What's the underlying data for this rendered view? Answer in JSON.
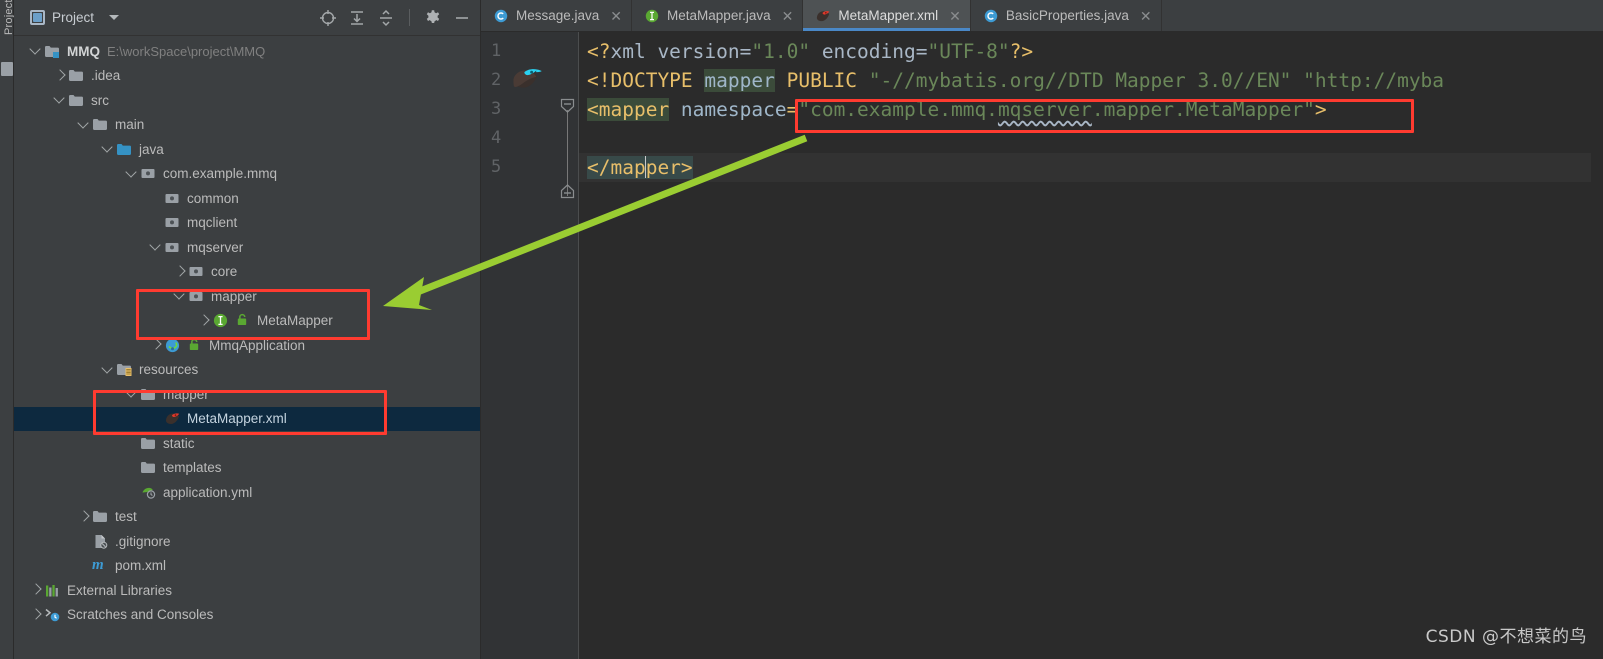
{
  "toolstrip": {
    "label": "Project"
  },
  "panel": {
    "title": "Project",
    "tools": [
      {
        "name": "locate-icon",
        "label": "Select Opened File"
      },
      {
        "name": "expand-all-icon",
        "label": "Expand All"
      },
      {
        "name": "collapse-all-icon",
        "label": "Collapse All"
      },
      {
        "name": "gear-icon",
        "label": "Settings"
      },
      {
        "name": "minimize-icon",
        "label": "Hide"
      }
    ]
  },
  "tree": [
    {
      "depth": 0,
      "arrow": "down",
      "icon": "module-folder-icon",
      "label": "MMQ",
      "bold": true,
      "sub": "E:\\workSpace\\project\\MMQ"
    },
    {
      "depth": 1,
      "arrow": "right",
      "icon": "folder-icon",
      "label": ".idea"
    },
    {
      "depth": 1,
      "arrow": "down",
      "icon": "folder-icon",
      "label": "src"
    },
    {
      "depth": 2,
      "arrow": "down",
      "icon": "folder-icon",
      "label": "main"
    },
    {
      "depth": 3,
      "arrow": "down",
      "icon": "source-folder-icon",
      "label": "java"
    },
    {
      "depth": 4,
      "arrow": "down",
      "icon": "package-icon",
      "label": "com.example.mmq"
    },
    {
      "depth": 5,
      "arrow": "none",
      "icon": "package-icon",
      "label": "common"
    },
    {
      "depth": 5,
      "arrow": "none",
      "icon": "package-icon",
      "label": "mqclient"
    },
    {
      "depth": 5,
      "arrow": "down",
      "icon": "package-icon",
      "label": "mqserver"
    },
    {
      "depth": 6,
      "arrow": "right",
      "icon": "package-icon",
      "label": "core"
    },
    {
      "depth": 6,
      "arrow": "down",
      "icon": "package-icon",
      "label": "mapper"
    },
    {
      "depth": 7,
      "arrow": "right",
      "icon": "interface-icon",
      "label": "MetaMapper",
      "badge": "lock-green-icon"
    },
    {
      "depth": 5,
      "arrow": "right",
      "icon": "spring-class-icon",
      "label": "MmqApplication",
      "badge": "lock-green-icon"
    },
    {
      "depth": 3,
      "arrow": "down",
      "icon": "resource-folder-icon",
      "label": "resources"
    },
    {
      "depth": 4,
      "arrow": "down",
      "icon": "folder-icon",
      "label": "mapper"
    },
    {
      "depth": 5,
      "arrow": "none",
      "icon": "mybatis-icon",
      "label": "MetaMapper.xml",
      "selected": true
    },
    {
      "depth": 4,
      "arrow": "none",
      "icon": "folder-icon",
      "label": "static"
    },
    {
      "depth": 4,
      "arrow": "none",
      "icon": "folder-icon",
      "label": "templates"
    },
    {
      "depth": 4,
      "arrow": "none",
      "icon": "yaml-icon",
      "label": "application.yml"
    },
    {
      "depth": 2,
      "arrow": "right",
      "icon": "folder-icon",
      "label": "test"
    },
    {
      "depth": 2,
      "arrow": "none",
      "icon": "gitignore-icon",
      "label": ".gitignore"
    },
    {
      "depth": 2,
      "arrow": "none",
      "icon": "maven-icon",
      "label": "pom.xml"
    },
    {
      "depth": 0,
      "arrow": "right",
      "icon": "libraries-icon",
      "label": "External Libraries"
    },
    {
      "depth": 0,
      "arrow": "right",
      "icon": "scratches-icon",
      "label": "Scratches and Consoles"
    }
  ],
  "tabs": [
    {
      "label": "Message.java",
      "icon": "java-class-icon",
      "active": false,
      "closable": true
    },
    {
      "label": "MetaMapper.java",
      "icon": "java-interface-icon",
      "active": false,
      "closable": true
    },
    {
      "label": "MetaMapper.xml",
      "icon": "mybatis-icon",
      "active": true,
      "closable": true
    },
    {
      "label": "BasicProperties.java",
      "icon": "java-class-icon",
      "active": false,
      "closable": true
    }
  ],
  "editor": {
    "line_numbers": [
      "1",
      "2",
      "3",
      "4",
      "5"
    ],
    "lines": {
      "l1_a": "<?",
      "l1_b": "xml version=",
      "l1_c": "\"1.0\"",
      "l1_d": " encoding=",
      "l1_e": "\"UTF-8\"",
      "l1_f": "?>",
      "l2_a": "<!DOCTYPE ",
      "l2_b": "mapper",
      "l2_c": " PUBLIC ",
      "l2_d": "\"-//mybatis.org//DTD Mapper 3.0//EN\" \"http://myba",
      "l3_a": "<mapper",
      "l3_b": " namespace",
      "l3_c": "=",
      "l3_d": "\"com.example.mmq.",
      "l3_e": "mqserver",
      "l3_f": ".mapper.MetaMapper\"",
      "l3_g": ">",
      "l5_a": "</map",
      "l5_b": "per>"
    },
    "gutter_icons": [
      {
        "name": "mybatis-bird-icon",
        "line": 3
      },
      {
        "name": "intention-bulb-icon",
        "line": 4
      }
    ]
  },
  "annotations": {
    "arrow": {
      "name": "green-arrow",
      "color": "#9acd32"
    },
    "boxes": [
      {
        "name": "highlight-box-mapper-package",
        "color": "#ff3b30"
      },
      {
        "name": "highlight-box-resources-mapper",
        "color": "#ff3b30"
      },
      {
        "name": "highlight-box-namespace-value",
        "color": "#ff3b30"
      }
    ]
  },
  "watermark": {
    "text": "CSDN @不想菜的鸟"
  },
  "colors": {
    "accent_tab": "#4a88c7",
    "selection": "#0d293f",
    "annotation_red": "#ff3b30",
    "annotation_green": "#9acd32",
    "string_green": "#6a8759",
    "tag_orange": "#e8bf6a"
  }
}
